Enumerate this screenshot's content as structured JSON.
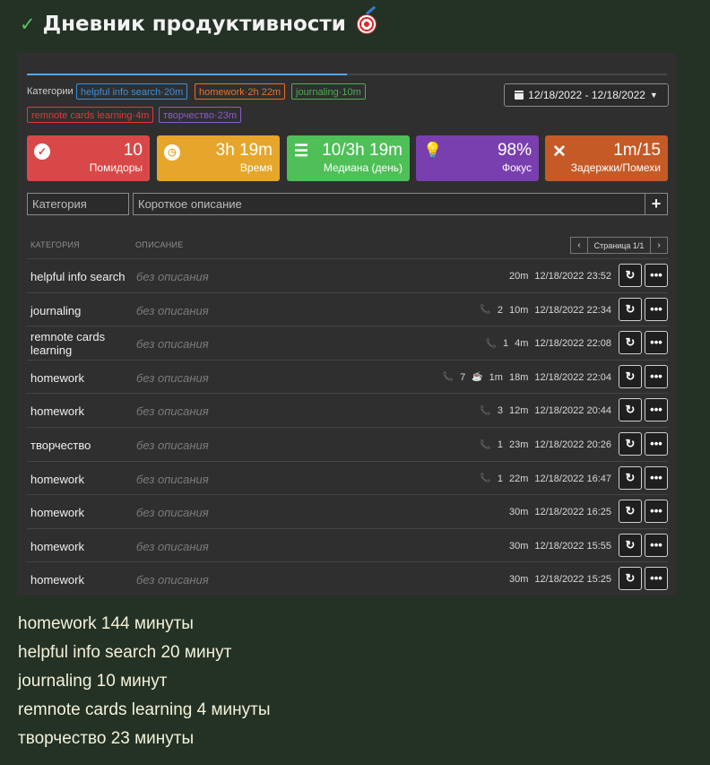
{
  "page": {
    "title": "Дневник продуктивности"
  },
  "filters": {
    "categories_label": "Категории",
    "tags": [
      {
        "label": "helpful info search·20m",
        "color": "#3d8fd6"
      },
      {
        "label": "homework·2h 22m",
        "color": "#e8722a"
      },
      {
        "label": "journaling·10m",
        "color": "#4caf50"
      },
      {
        "label": "remnote cards learning·4m",
        "color": "#e0383e"
      },
      {
        "label": "творчество·23m",
        "color": "#8a5cc9"
      }
    ],
    "date_range": "12/18/2022 - 12/18/2022"
  },
  "stats": [
    {
      "value": "10",
      "label": "Помидоры",
      "icon": "check-circle-icon",
      "color": "#d94848"
    },
    {
      "value": "3h 19m",
      "label": "Время",
      "icon": "clock-icon",
      "color": "#e5a62b"
    },
    {
      "value": "10/3h 19m",
      "label": "Медиана (день)",
      "icon": "list-icon",
      "color": "#4fbf57"
    },
    {
      "value": "98%",
      "label": "Фокус",
      "icon": "lightbulb-icon",
      "color": "#7a3fae"
    },
    {
      "value": "1m/15",
      "label": "Задержки/Помехи",
      "icon": "times-icon",
      "color": "#c55a26"
    }
  ],
  "entry_form": {
    "category_placeholder": "Категория",
    "description_placeholder": "Короткое описание",
    "add_label": "+"
  },
  "table": {
    "col_category": "КАТЕГОРИЯ",
    "col_description": "ОПИСАНИЕ",
    "pager": {
      "prev": "‹",
      "label": "Страница 1/1",
      "next": "›"
    },
    "rows": [
      {
        "category": "helpful info search",
        "description": "без описания",
        "calls": "",
        "breaks": "",
        "duration": "20m",
        "datetime": "12/18/2022 23:52"
      },
      {
        "category": "journaling",
        "description": "без описания",
        "calls": "2",
        "breaks": "",
        "duration": "10m",
        "datetime": "12/18/2022 22:34"
      },
      {
        "category": "remnote cards learning",
        "description": "без описания",
        "calls": "1",
        "breaks": "",
        "duration": "4m",
        "datetime": "12/18/2022 22:08"
      },
      {
        "category": "homework",
        "description": "без описания",
        "calls": "7",
        "breaks": "1m",
        "duration": "18m",
        "datetime": "12/18/2022 22:04"
      },
      {
        "category": "homework",
        "description": "без описания",
        "calls": "3",
        "breaks": "",
        "duration": "12m",
        "datetime": "12/18/2022 20:44"
      },
      {
        "category": "творчество",
        "description": "без описания",
        "calls": "1",
        "breaks": "",
        "duration": "23m",
        "datetime": "12/18/2022 20:26"
      },
      {
        "category": "homework",
        "description": "без описания",
        "calls": "1",
        "breaks": "",
        "duration": "22m",
        "datetime": "12/18/2022 16:47"
      },
      {
        "category": "homework",
        "description": "без описания",
        "calls": "",
        "breaks": "",
        "duration": "30m",
        "datetime": "12/18/2022 16:25"
      },
      {
        "category": "homework",
        "description": "без описания",
        "calls": "",
        "breaks": "",
        "duration": "30m",
        "datetime": "12/18/2022 15:55"
      },
      {
        "category": "homework",
        "description": "без описания",
        "calls": "",
        "breaks": "",
        "duration": "30m",
        "datetime": "12/18/2022 15:25"
      }
    ]
  },
  "summary": [
    "homework 144 минуты",
    "helpful info search 20 минут",
    "journaling 10 минут",
    "remnote cards learning 4 минуты",
    "творчество 23 минуты"
  ]
}
